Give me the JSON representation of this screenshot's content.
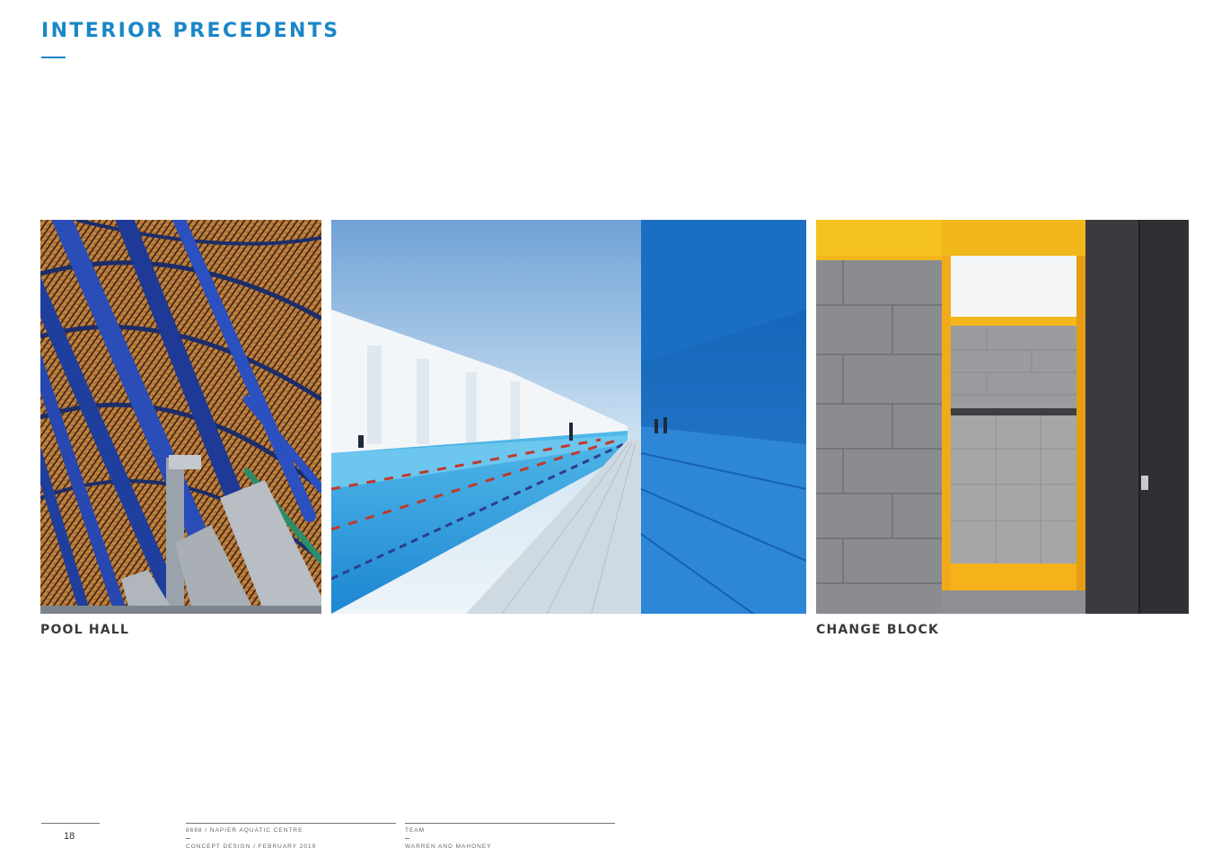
{
  "header": {
    "title": "INTERIOR PRECEDENTS"
  },
  "photos": [
    {
      "caption": "POOL HALL"
    },
    {
      "caption": ""
    },
    {
      "caption": "CHANGE BLOCK"
    }
  ],
  "footer": {
    "page_number": "18",
    "project": "8698 / NAPIER AQUATIC CENTRE",
    "stage": "CONCEPT DESIGN / FEBRUARY 2019",
    "team_label": "TEAM",
    "team_name": "WARREN AND MAHONEY"
  },
  "colors": {
    "accent": "#1a86c8"
  }
}
